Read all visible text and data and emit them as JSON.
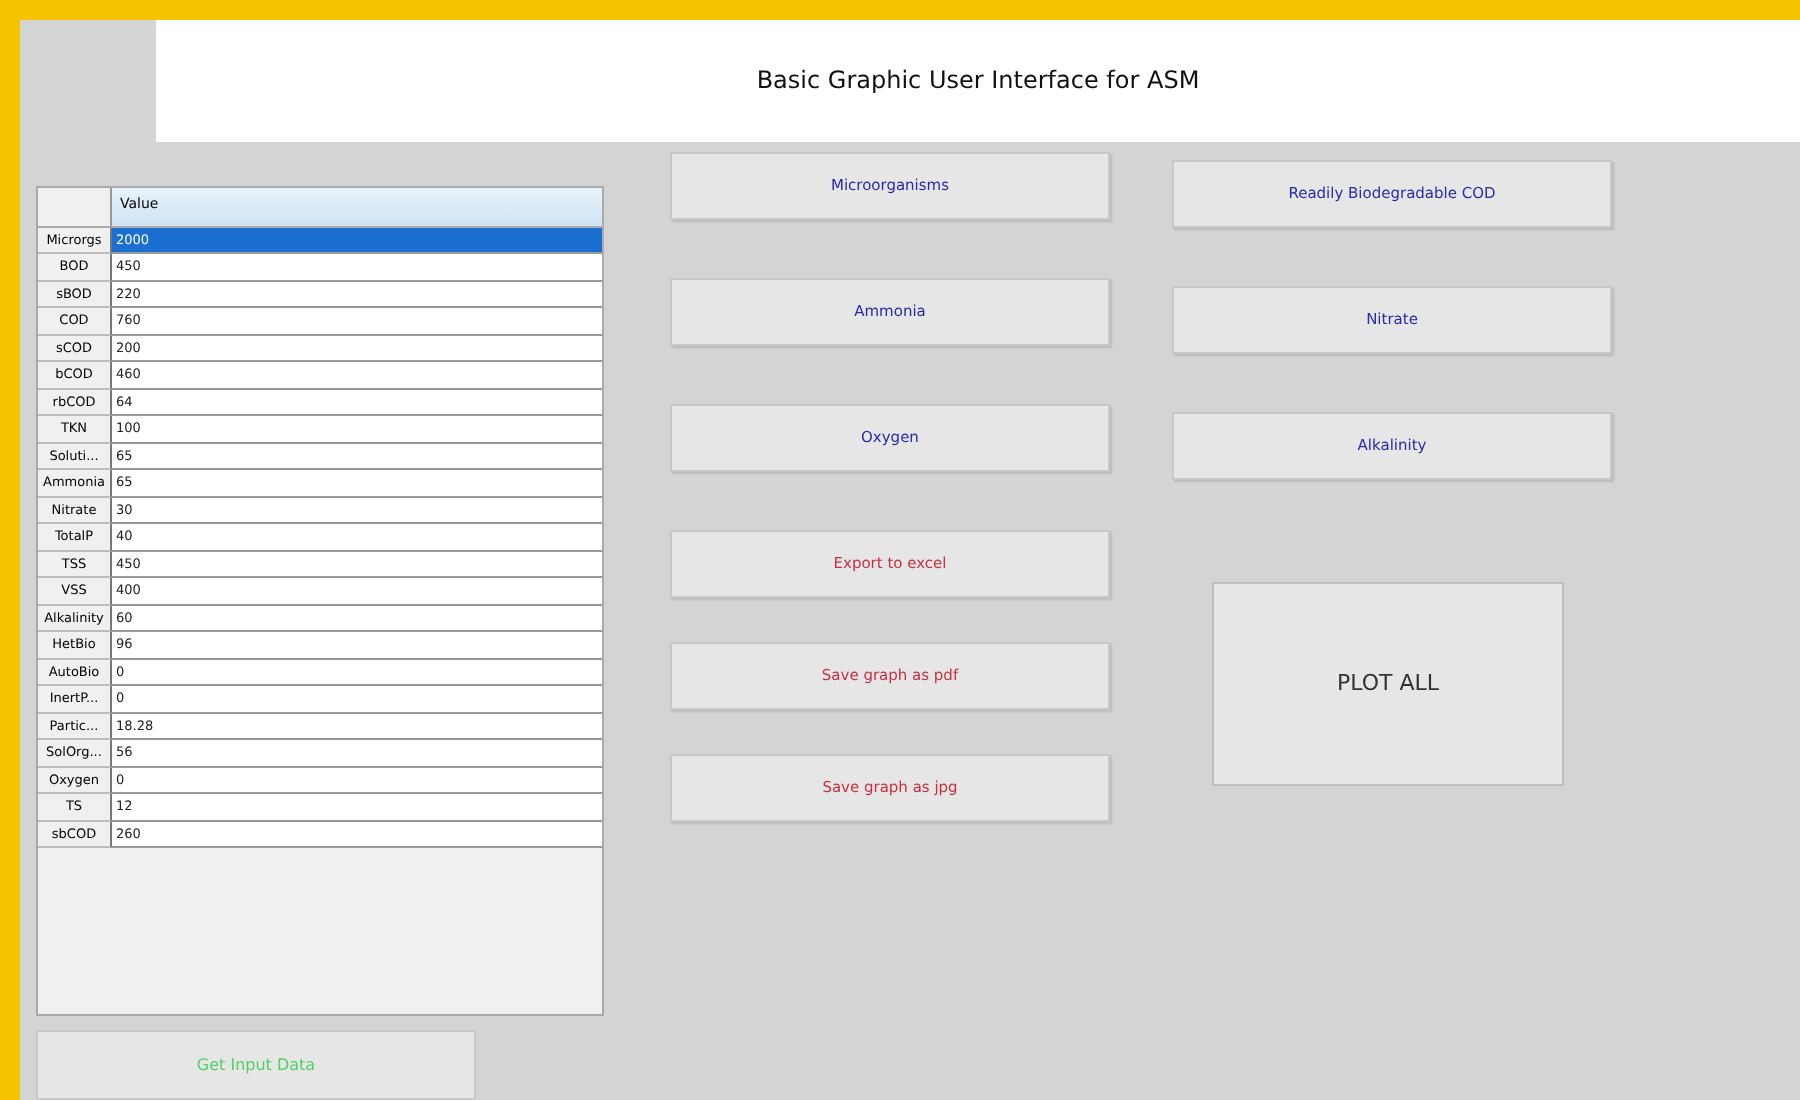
{
  "window": {
    "title": "Basic Graphic User Interface for ASM"
  },
  "table": {
    "columns": [
      "Value"
    ],
    "rows": [
      {
        "label": "Microrgs",
        "value": "2000",
        "selected": true
      },
      {
        "label": "BOD",
        "value": "450",
        "selected": false
      },
      {
        "label": "sBOD",
        "value": "220",
        "selected": false
      },
      {
        "label": "COD",
        "value": "760",
        "selected": false
      },
      {
        "label": "sCOD",
        "value": "200",
        "selected": false
      },
      {
        "label": "bCOD",
        "value": "460",
        "selected": false
      },
      {
        "label": "rbCOD",
        "value": "64",
        "selected": false
      },
      {
        "label": "TKN",
        "value": "100",
        "selected": false
      },
      {
        "label": "Soluti...",
        "value": "65",
        "selected": false
      },
      {
        "label": "Ammonia",
        "value": "65",
        "selected": false
      },
      {
        "label": "Nitrate",
        "value": "30",
        "selected": false
      },
      {
        "label": "TotalP",
        "value": "40",
        "selected": false
      },
      {
        "label": "TSS",
        "value": "450",
        "selected": false
      },
      {
        "label": "VSS",
        "value": "400",
        "selected": false
      },
      {
        "label": "Alkalinity",
        "value": "60",
        "selected": false
      },
      {
        "label": "HetBio",
        "value": "96",
        "selected": false
      },
      {
        "label": "AutoBio",
        "value": "0",
        "selected": false
      },
      {
        "label": "InertP...",
        "value": "0",
        "selected": false
      },
      {
        "label": "Partic...",
        "value": "18.28",
        "selected": false
      },
      {
        "label": "SolOrg...",
        "value": "56",
        "selected": false
      },
      {
        "label": "Oxygen",
        "value": "0",
        "selected": false
      },
      {
        "label": "TS",
        "value": "12",
        "selected": false
      },
      {
        "label": "sbCOD",
        "value": "260",
        "selected": false
      }
    ]
  },
  "plot_buttons_left": [
    {
      "label": "Microorganisms",
      "color": "#2a2aa8"
    },
    {
      "label": "Ammonia",
      "color": "#2a2aa8"
    },
    {
      "label": "Oxygen",
      "color": "#2a2aa8"
    },
    {
      "label": "Export to excel",
      "color": "#c83040"
    },
    {
      "label": "Save graph as pdf",
      "color": "#c83040"
    },
    {
      "label": "Save graph as jpg",
      "color": "#c83040"
    }
  ],
  "plot_buttons_right": [
    {
      "label": "Readily Biodegradable COD",
      "color": "#2a2aa8"
    },
    {
      "label": "Nitrate",
      "color": "#2a2aa8"
    },
    {
      "label": "Alkalinity",
      "color": "#2a2aa8"
    }
  ],
  "plot_all_button": "PLOT ALL",
  "input_button": {
    "label": "Get Input Data",
    "color": "#50d060"
  }
}
